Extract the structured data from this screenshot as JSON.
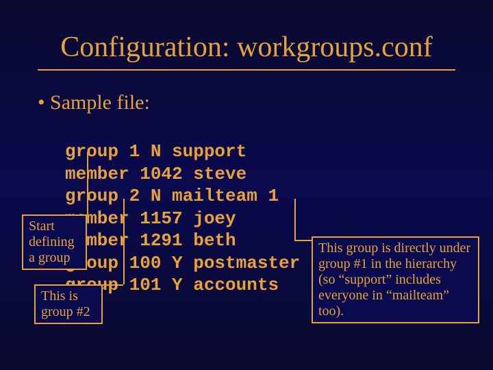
{
  "title": "Configuration: workgroups.conf",
  "bullet": "Sample file:",
  "code": "group 1 N support\nmember 1042 steve\ngroup 2 N mailteam 1\nmember 1157 joey\nmember 1291 beth\ngroup 100 Y postmaster\ngroup 101 Y accounts",
  "callouts": {
    "start_defining": "Start defining a group",
    "group2": "This is group #2",
    "hierarchy": "This group is directly under group #1 in the hierarchy (so “support” includes everyone in “mailteam” too)."
  }
}
